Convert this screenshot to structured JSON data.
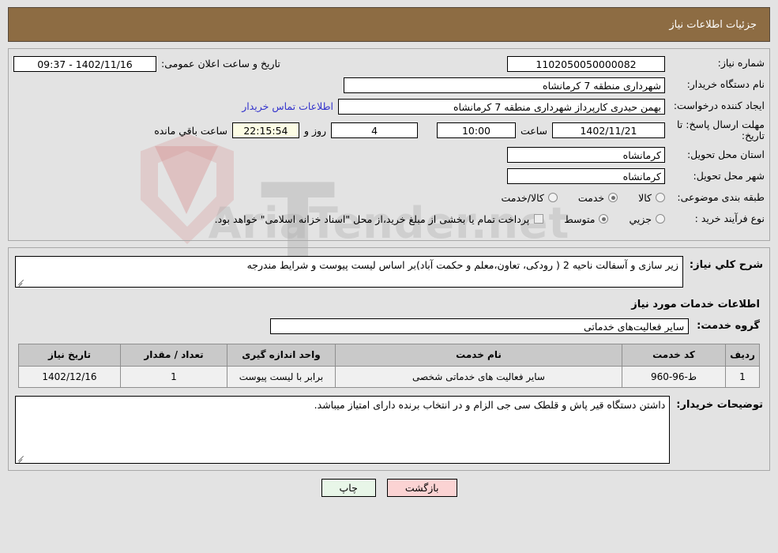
{
  "header": {
    "title": "جزئیات اطلاعات نیاز"
  },
  "watermark": {
    "text": "AriaTender.net",
    "big": "T"
  },
  "form": {
    "need_number": {
      "label": "شماره نیاز:",
      "value": "1102050050000082"
    },
    "announce_datetime": {
      "label": "تاریخ و ساعت اعلان عمومی:",
      "value": "1402/11/16 - 09:37"
    },
    "buyer_org": {
      "label": "نام دستگاه خریدار:",
      "value": "شهرداری منطقه 7 کرمانشاه"
    },
    "creator": {
      "label": "ایجاد کننده درخواست:",
      "value": "بهمن حیدری کارپرداز شهرداری منطقه 7 کرمانشاه"
    },
    "contact_link": "اطلاعات تماس خریدار",
    "deadline": {
      "label": "مهلت ارسال پاسخ: تا تاریخ:",
      "date": "1402/11/21",
      "hour_label": "ساعت",
      "hour": "10:00",
      "days": "4",
      "days_label": "روز و",
      "timer": "22:15:54",
      "timer_label": "ساعت باقي مانده"
    },
    "province": {
      "label": "استان محل تحویل:",
      "value": "کرمانشاه"
    },
    "city": {
      "label": "شهر محل تحویل:",
      "value": "کرمانشاه"
    },
    "category": {
      "label": "طبقه بندی موضوعی:",
      "options": [
        {
          "label": "کالا",
          "selected": false
        },
        {
          "label": "خدمت",
          "selected": true
        },
        {
          "label": "کالا/خدمت",
          "selected": false
        }
      ]
    },
    "purchase_type": {
      "label": "نوع فرآیند خرید :",
      "options": [
        {
          "label": "جزیي",
          "selected": false
        },
        {
          "label": "متوسط",
          "selected": true
        }
      ],
      "checkbox_note": "پرداخت تمام یا بخشی از مبلغ خرید،از محل \"اسناد خزانه اسلامی\" خواهد بود."
    }
  },
  "description": {
    "label": "شرح کلي نیاز:",
    "value": "زیر سازی و آسفالت ناحیه 2 ( رودکی، تعاون،معلم و حکمت آباد)بر اساس لیست پیوست و شرایط مندرجه"
  },
  "services_section": {
    "title": "اطلاعات خدمات مورد نیاز",
    "group": {
      "label": "گروه خدمت:",
      "value": "سایر فعالیت‌های خدماتی"
    }
  },
  "table": {
    "columns": [
      "ردیف",
      "کد خدمت",
      "نام خدمت",
      "واحد اندازه گیری",
      "تعداد / مقدار",
      "تاریخ نیاز"
    ],
    "rows": [
      {
        "radif": "1",
        "code": "ط-96-960",
        "name": "سایر فعالیت های خدماتی شخصی",
        "unit": "برابر با لیست پیوست",
        "qty": "1",
        "date": "1402/12/16"
      }
    ]
  },
  "buyer_notes": {
    "label": "توضیحات خریدار:",
    "value": "داشتن دستگاه قیر پاش و قلطک سی جی الزام و در انتخاب برنده دارای امتیاز میباشد."
  },
  "buttons": {
    "print": "چاپ",
    "back": "بازگشت"
  }
}
